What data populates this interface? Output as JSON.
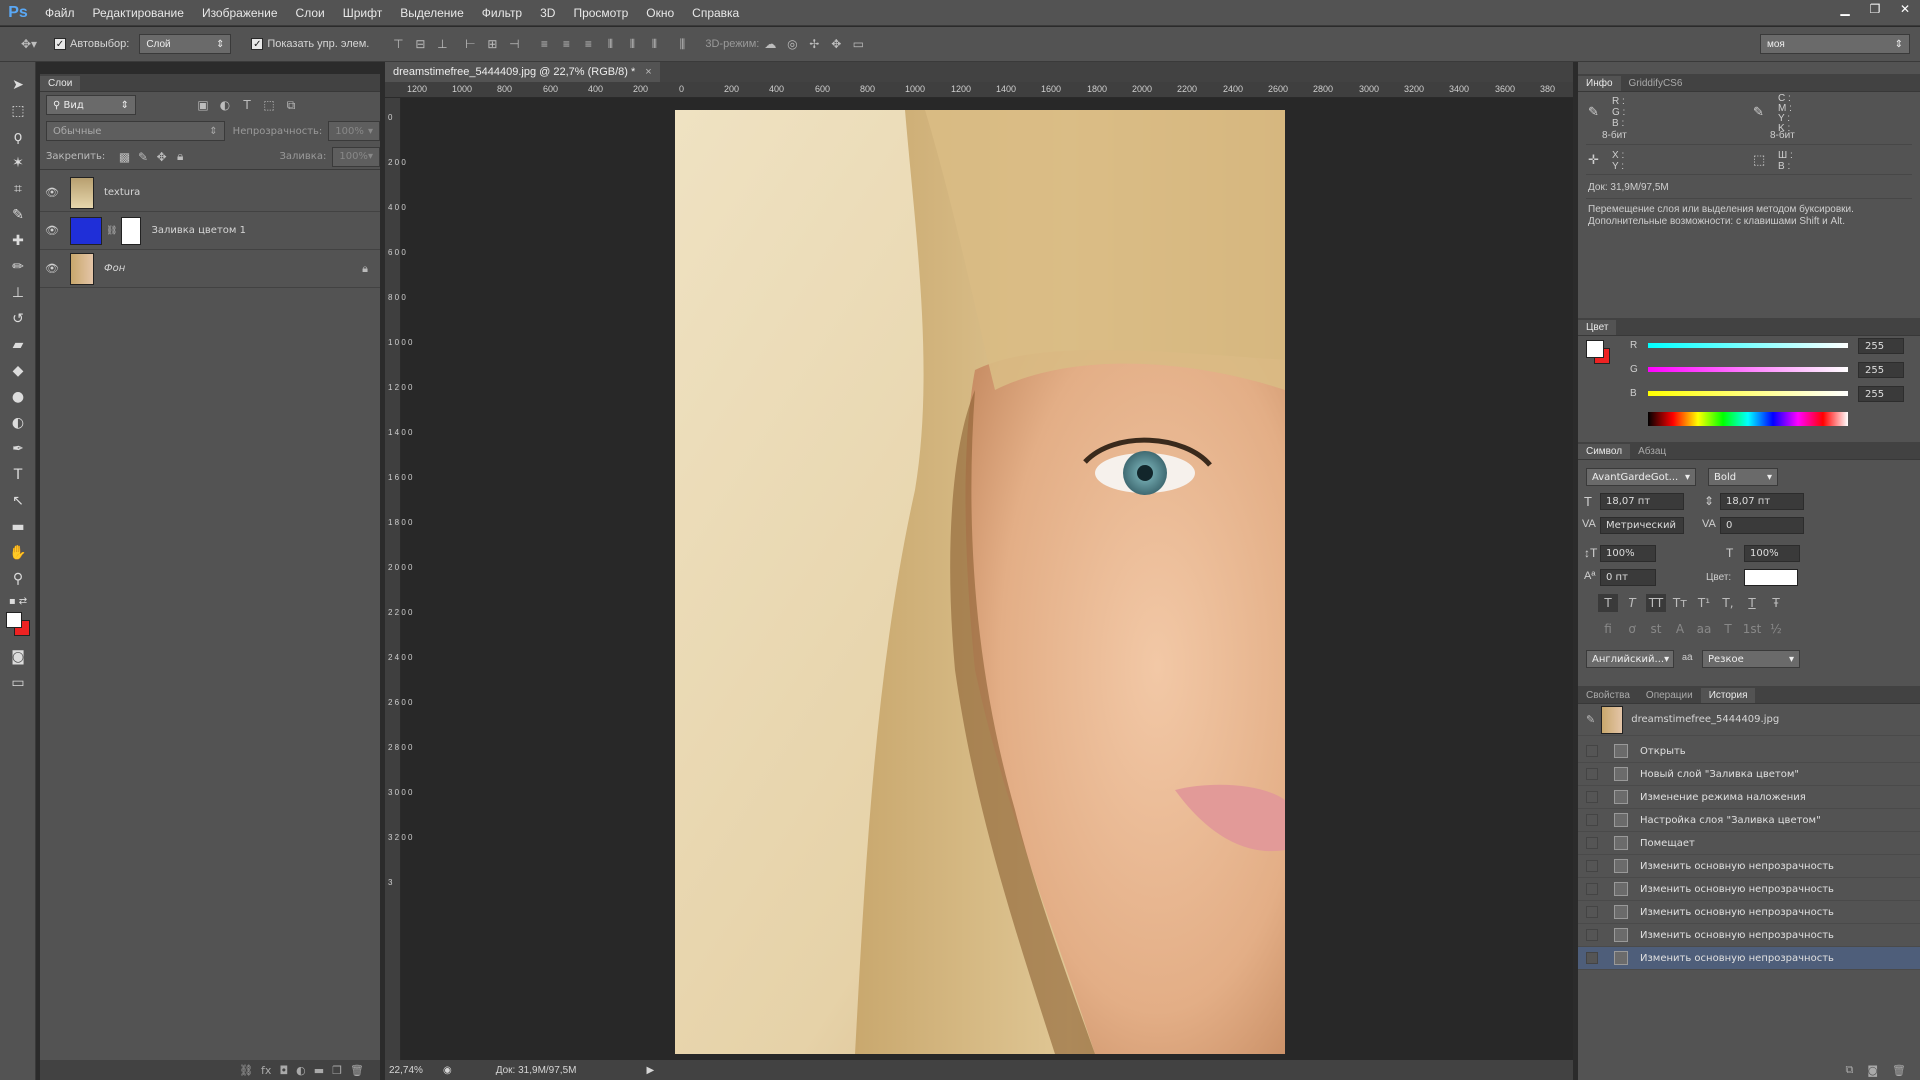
{
  "app": {
    "logo": "Ps"
  },
  "menu": [
    "Файл",
    "Редактирование",
    "Изображение",
    "Слои",
    "Шрифт",
    "Выделение",
    "Фильтр",
    "3D",
    "Просмотр",
    "Окно",
    "Справка"
  ],
  "options": {
    "autoselect_label": "Автовыбор:",
    "autoselect_value": "Слой",
    "show_controls_label": "Показать упр. элем.",
    "mode3d_label": "3D-режим:",
    "workspace": "моя"
  },
  "layers_panel": {
    "tab": "Слои",
    "filter_kind": "Вид",
    "blend_mode": "Обычные",
    "opacity_label": "Непрозрачность:",
    "opacity_value": "100%",
    "lock_label": "Закрепить:",
    "fill_label": "Заливка:",
    "fill_value": "100%",
    "layers": [
      {
        "name": "textura"
      },
      {
        "name": "Заливка цветом 1"
      },
      {
        "name": "Фон"
      }
    ]
  },
  "document": {
    "tab_title": "dreamstimefree_5444409.jpg @ 22,7% (RGB/8) *",
    "ruler_h": [
      "1200",
      "1000",
      "800",
      "600",
      "400",
      "200",
      "0",
      "200",
      "400",
      "600",
      "800",
      "1000",
      "1200",
      "1400",
      "1600",
      "1800",
      "2000",
      "2200",
      "2400",
      "2600",
      "2800",
      "3000",
      "3200",
      "3400",
      "3600",
      "380"
    ],
    "ruler_v": [
      "0",
      "2 0 0",
      "4 0 0",
      "6 0 0",
      "8 0 0",
      "1 0 0 0",
      "1 2 0 0",
      "1 4 0 0",
      "1 6 0 0",
      "1 8 0 0",
      "2 0 0 0",
      "2 2 0 0",
      "2 4 0 0",
      "2 6 0 0",
      "2 8 0 0",
      "3 0 0 0",
      "3 2 0 0",
      "3"
    ],
    "zoom": "22,74%",
    "doc_size": "Док: 31,9M/97,5M"
  },
  "info_panel": {
    "tabs": [
      "Инфо",
      "GriddifyCS6"
    ],
    "rgb_labels": "R :\nG :\nB :",
    "cmyk_labels": "C :\nM :\nY :\nK :",
    "bit_left": "8-бит",
    "bit_right": "8-бит",
    "xy_labels": "X :\nY :",
    "wh_labels": "Ш :\nВ :",
    "doc_size": "Док: 31,9M/97,5M",
    "hint_line1": "Перемещение слоя или выделения методом буксировки.",
    "hint_line2": "Дополнительные возможности: с клавишами Shift и Alt."
  },
  "color_panel": {
    "tab": "Цвет",
    "r_label": "R",
    "g_label": "G",
    "b_label": "B",
    "r": "255",
    "g": "255",
    "b": "255"
  },
  "character_panel": {
    "tabs": [
      "Символ",
      "Абзац"
    ],
    "font": "AvantGardeGot...",
    "style": "Bold",
    "size": "18,07 пт",
    "leading": "18,07 пт",
    "kerning": "Метрический",
    "tracking": "0",
    "vscale": "100%",
    "hscale": "100%",
    "baseline": "0 пт",
    "color_label": "Цвет:",
    "language": "Английский...",
    "aa_label": "a",
    "antialias": "Резкое",
    "style_glyphs": [
      "T",
      "T",
      "TT",
      "Tт",
      "T¹",
      "T,",
      "T",
      "Ŧ"
    ],
    "ot_glyphs": [
      "ﬁ",
      "ơ",
      "st",
      "A",
      "aa",
      "T",
      "1st",
      "½"
    ]
  },
  "history_panel": {
    "tabs": [
      "Свойства",
      "Операции",
      "История"
    ],
    "snapshot": "dreamstimefree_5444409.jpg",
    "items": [
      "Открыть",
      "Новый слой \"Заливка цветом\"",
      "Изменение режима наложения",
      "Настройка слоя \"Заливка цветом\"",
      "Помещает",
      "Изменить основную непрозрачность",
      "Изменить основную непрозрачность",
      "Изменить основную непрозрачность",
      "Изменить основную непрозрачность",
      "Изменить основную непрозрачность"
    ]
  },
  "colors": {
    "accent": "#5aa8f5",
    "fill_layer": "#1f2fd8",
    "history_active": "#4e5e7a"
  }
}
